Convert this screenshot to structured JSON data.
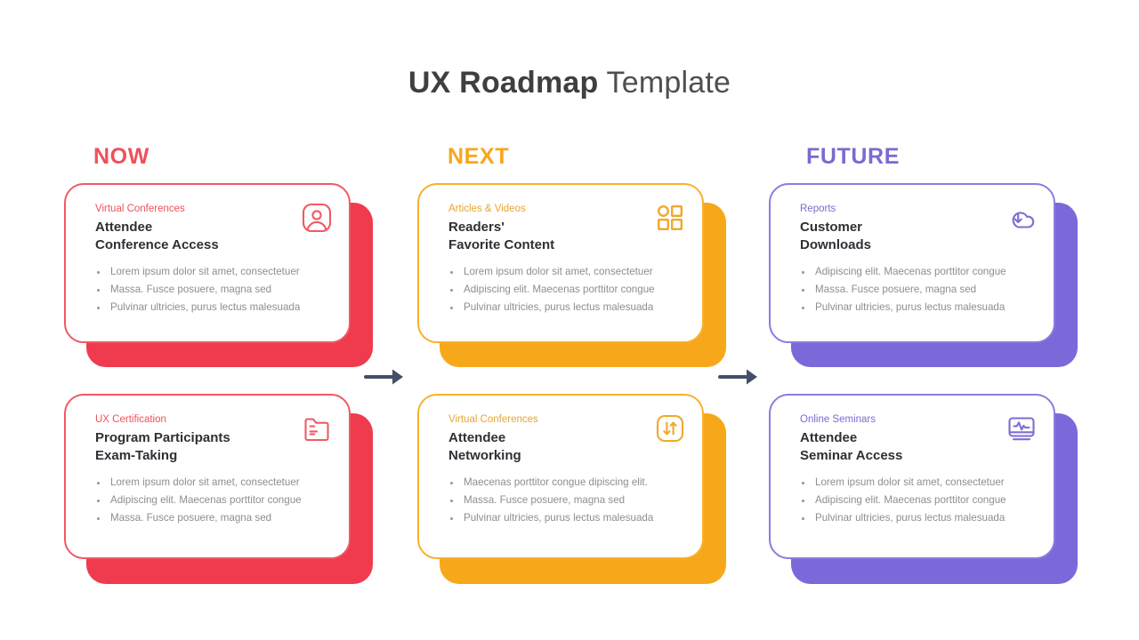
{
  "title": {
    "bold_part": "UX Roadmap",
    "light_part": " Template"
  },
  "colors": {
    "now": "#f0505a",
    "next": "#f8a61c",
    "future": "#7a6bd0",
    "arrow": "#44506a",
    "title_text": "#4a4a4a",
    "body_text": "#8d8d94"
  },
  "columns": [
    {
      "label": "NOW",
      "theme": "red"
    },
    {
      "label": "NEXT",
      "theme": "orange"
    },
    {
      "label": "FUTURE",
      "theme": "purple"
    }
  ],
  "arrows": [
    {
      "name": "arrow-now-to-next",
      "glyph": "right-arrow-icon"
    },
    {
      "name": "arrow-next-to-future",
      "glyph": "right-arrow-icon"
    }
  ],
  "cards": [
    {
      "eyebrow": "Virtual Conferences",
      "title": "Attendee\nConference Access",
      "icon": "user-avatar-icon",
      "bullets": [
        "Lorem ipsum dolor sit amet, consectetuer",
        "Massa. Fusce posuere, magna sed",
        "Pulvinar ultricies, purus lectus malesuada"
      ]
    },
    {
      "eyebrow": "Articles & Videos",
      "title": "Readers'\nFavorite Content",
      "icon": "grid-dashboard-icon",
      "bullets": [
        "Lorem ipsum dolor sit amet, consectetuer",
        "Adipiscing elit. Maecenas porttitor congue",
        "Pulvinar ultricies, purus lectus malesuada"
      ]
    },
    {
      "eyebrow": "Reports",
      "title": "Customer\nDownloads",
      "icon": "cloud-download-icon",
      "bullets": [
        "Adipiscing elit. Maecenas porttitor congue",
        "Massa. Fusce posuere, magna sed",
        "Pulvinar ultricies, purus lectus malesuada"
      ]
    },
    {
      "eyebrow": "UX Certification",
      "title": "Program Participants\nExam-Taking",
      "icon": "folder-icon",
      "bullets": [
        "Lorem ipsum dolor sit amet, consectetuer",
        "Adipiscing elit. Maecenas porttitor congue",
        "Massa. Fusce posuere, magna sed"
      ]
    },
    {
      "eyebrow": "Virtual Conferences",
      "title": "Attendee\nNetworking",
      "icon": "transfer-arrows-icon",
      "bullets": [
        "Maecenas porttitor congue dipiscing elit.",
        "Massa. Fusce posuere, magna sed",
        "Pulvinar ultricies, purus lectus malesuada"
      ]
    },
    {
      "eyebrow": "Online Seminars",
      "title": "Attendee\nSeminar Access",
      "icon": "monitor-pulse-icon",
      "bullets": [
        "Lorem ipsum dolor sit amet, consectetuer",
        "Adipiscing elit. Maecenas porttitor congue",
        "Pulvinar ultricies, purus lectus malesuada"
      ]
    }
  ]
}
